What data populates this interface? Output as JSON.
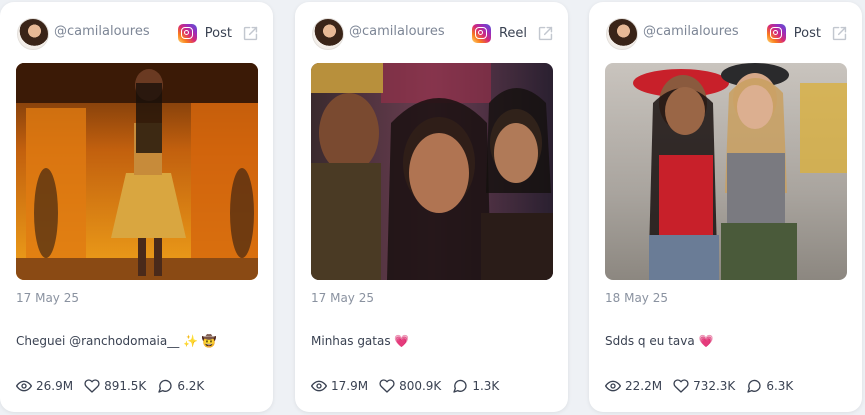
{
  "cards": [
    {
      "username": "@camilaloures",
      "post_type": "Post",
      "date": "17 May 25",
      "caption": "Cheguei @ranchodomaia__ ✨ 🤠",
      "views": "26.9M",
      "likes": "891.5K",
      "comments": "6.2K"
    },
    {
      "username": "@camilaloures",
      "post_type": "Reel",
      "date": "17 May 25",
      "caption": "Minhas gatas 💗",
      "views": "17.9M",
      "likes": "800.9K",
      "comments": "1.3K"
    },
    {
      "username": "@camilaloures",
      "post_type": "Post",
      "date": "18 May 25",
      "caption": "Sdds q eu tava 💗",
      "views": "22.2M",
      "likes": "732.3K",
      "comments": "6.3K"
    }
  ],
  "icons": {
    "platform": "instagram-icon",
    "external": "external-link-icon",
    "views": "eye-icon",
    "likes": "heart-icon",
    "comments": "comment-icon"
  }
}
